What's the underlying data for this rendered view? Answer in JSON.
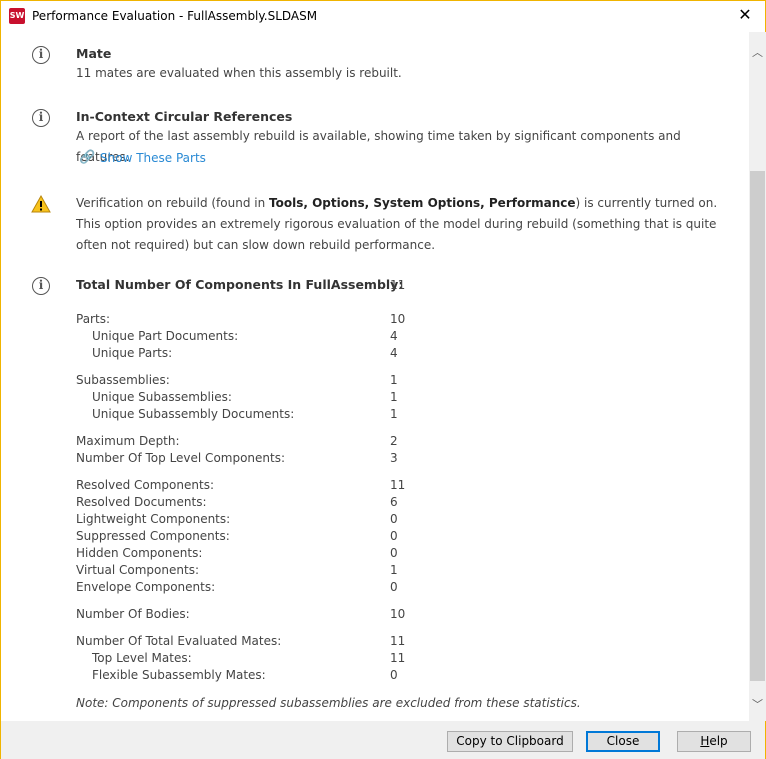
{
  "window": {
    "title": "Performance Evaluation - FullAssembly.SLDASM",
    "app_icon": "SW",
    "close": "✕",
    "border_color": "#f0b400"
  },
  "mate": {
    "heading": "Mate",
    "text": "11 mates are evaluated when this assembly is rebuilt."
  },
  "circular": {
    "heading": "In-Context Circular References",
    "text": "A report of the last assembly rebuild is available, showing time taken by significant components and features.",
    "link": "Show These Parts"
  },
  "verification": {
    "pre": "Verification on rebuild (found in ",
    "bold": "Tools, Options, System Options, Performance",
    "post": ") is currently turned on. This option provides an extremely rigorous evaluation of the model during rebuild (something that is quite often not required) but can slow down rebuild performance."
  },
  "stats": {
    "heading": "Total Number Of Components In FullAssembly:",
    "total": "11",
    "rows": [
      {
        "label": "Parts:",
        "value": "10",
        "indent": false
      },
      {
        "label": "Unique Part Documents:",
        "value": "4",
        "indent": true
      },
      {
        "label": "Unique Parts:",
        "value": "4",
        "indent": true
      },
      {
        "label": "Subassemblies:",
        "value": "1",
        "indent": false
      },
      {
        "label": "Unique Subassemblies:",
        "value": "1",
        "indent": true
      },
      {
        "label": "Unique Subassembly Documents:",
        "value": "1",
        "indent": true
      },
      {
        "label": "Maximum Depth:",
        "value": "2",
        "indent": false
      },
      {
        "label": "Number Of Top Level Components:",
        "value": "3",
        "indent": false
      },
      {
        "label": "Resolved Components:",
        "value": "11",
        "indent": false
      },
      {
        "label": "Resolved Documents:",
        "value": "6",
        "indent": false
      },
      {
        "label": "Lightweight Components:",
        "value": "0",
        "indent": false
      },
      {
        "label": "Suppressed Components:",
        "value": "0",
        "indent": false
      },
      {
        "label": "Hidden Components:",
        "value": "0",
        "indent": false
      },
      {
        "label": "Virtual Components:",
        "value": "1",
        "indent": false
      },
      {
        "label": "Envelope Components:",
        "value": "0",
        "indent": false
      },
      {
        "label": "Number Of Bodies:",
        "value": "10",
        "indent": false
      },
      {
        "label": "Number Of Total Evaluated Mates:",
        "value": "11",
        "indent": false
      },
      {
        "label": "Top Level Mates:",
        "value": "11",
        "indent": true
      },
      {
        "label": "Flexible Subassembly Mates:",
        "value": "0",
        "indent": true
      }
    ],
    "note": "Note: Components of suppressed subassemblies are excluded from these statistics."
  },
  "buttons": {
    "copy": "Copy to Clipboard",
    "close": "Close",
    "help_u": "H",
    "help_rest": "elp"
  }
}
